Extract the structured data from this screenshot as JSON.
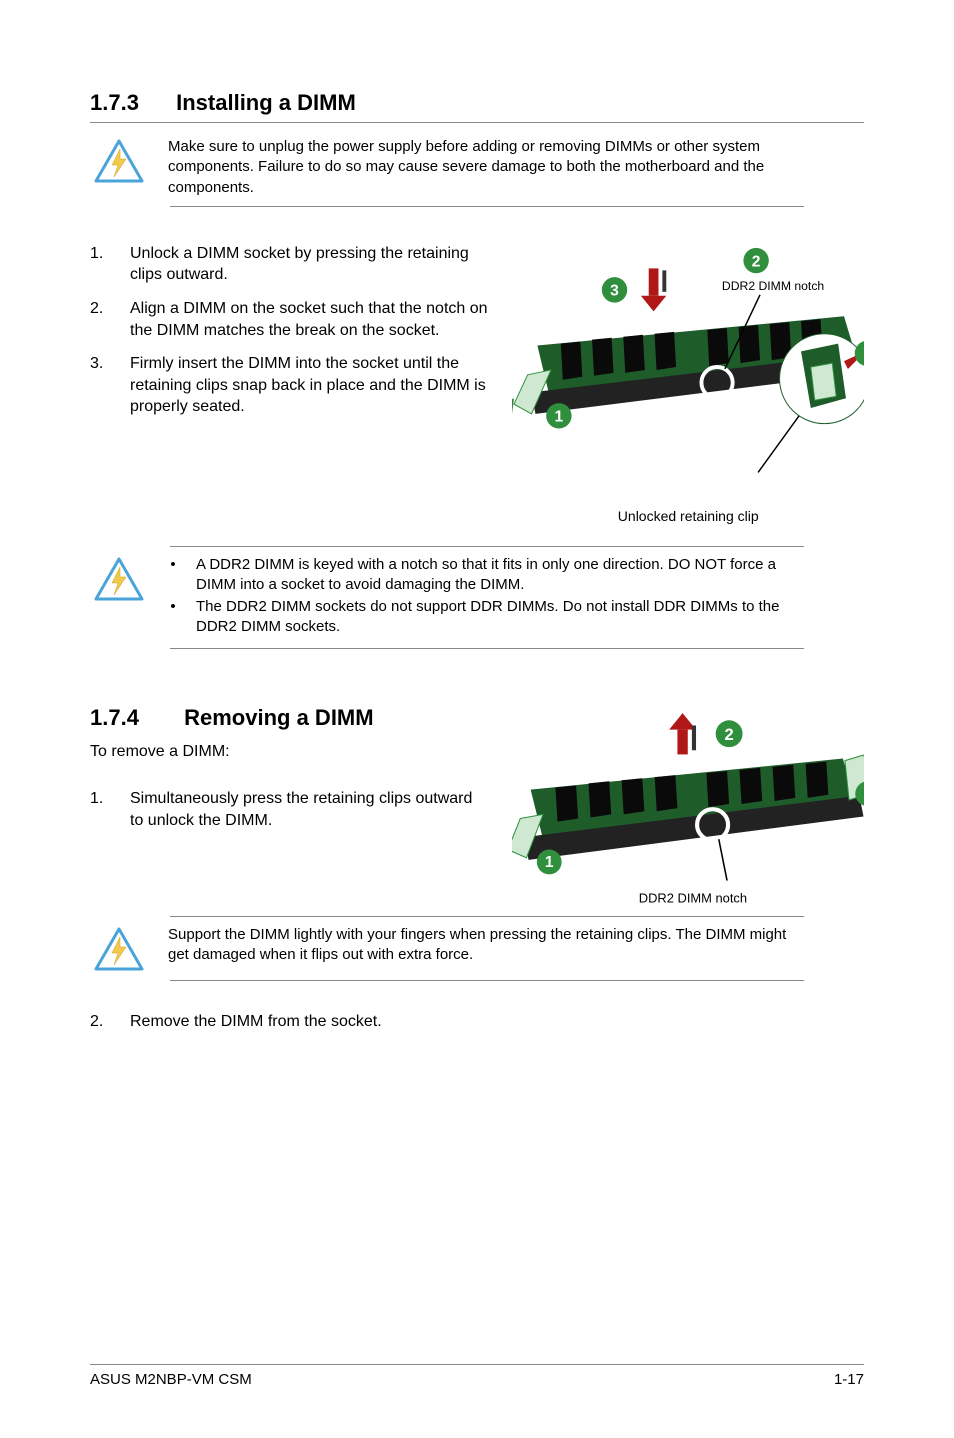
{
  "section1": {
    "number": "1.7.3",
    "title": "Installing a DIMM",
    "warning": "Make sure to unplug the power supply before adding or removing DIMMs or other system components. Failure to do so may cause severe damage to both the motherboard and the components.",
    "steps": [
      {
        "n": "1.",
        "t": "Unlock a DIMM socket by pressing the retaining clips outward."
      },
      {
        "n": "2.",
        "t": "Align a DIMM on the socket such that the notch on the DIMM matches the break on the socket."
      },
      {
        "n": "3.",
        "t": "Firmly insert the DIMM into the socket until the retaining clips snap back in place and the DIMM is properly seated."
      }
    ],
    "fig": {
      "notch_label": "DDR2 DIMM notch",
      "caption": "Unlocked retaining clip",
      "badge1": "1",
      "badge2": "2",
      "badge3": "3"
    },
    "notes": [
      "A DDR2 DIMM is  keyed with a notch so that it fits in only one direction. DO NOT force a DIMM into a socket to avoid damaging the DIMM.",
      "The DDR2 DIMM sockets do not support DDR DIMMs. Do not install DDR DIMMs to the DDR2 DIMM sockets."
    ]
  },
  "section2": {
    "number": "1.7.4",
    "title": "Removing a DIMM",
    "intro": "To remove a DIMM:",
    "steps": [
      {
        "n": "1.",
        "t": "Simultaneously press the retaining clips outward to unlock the DIMM."
      }
    ],
    "fig": {
      "notch_label": "DDR2 DIMM notch",
      "badge1": "1",
      "badge2": "2"
    },
    "warning": "Support the DIMM lightly with your fingers when pressing the retaining clips. The DIMM might get damaged when it flips out with extra force.",
    "steps2": [
      {
        "n": "2.",
        "t": "Remove the DIMM from the socket."
      }
    ]
  },
  "footer": {
    "left": "ASUS M2NBP-VM CSM",
    "right": "1-17"
  }
}
